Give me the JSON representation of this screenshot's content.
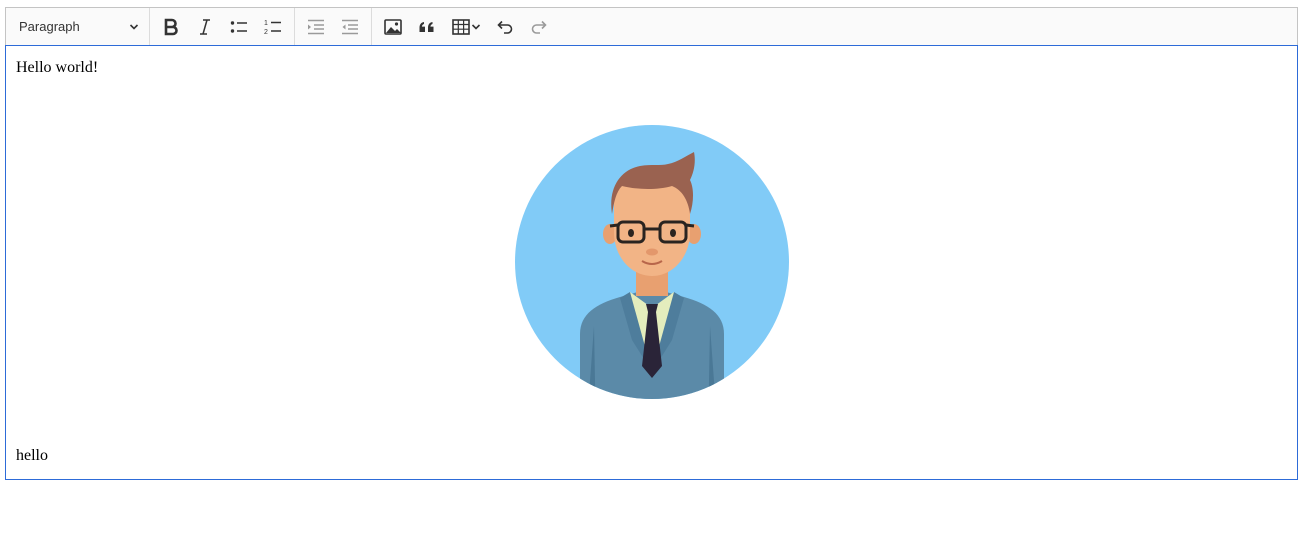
{
  "toolbar": {
    "heading_label": "Paragraph",
    "icons": {
      "dropdown": "chevron-down-icon",
      "bold": "bold-icon",
      "italic": "italic-icon",
      "bulleted_list": "bulleted-list-icon",
      "numbered_list": "numbered-list-icon",
      "decrease_indent": "outdent-icon",
      "increase_indent": "indent-icon",
      "image": "image-icon",
      "quote": "quote-icon",
      "table": "table-icon",
      "undo": "undo-icon",
      "redo": "redo-icon"
    }
  },
  "content": {
    "paragraph1": "Hello world!",
    "image": "businessman-avatar",
    "paragraph2": "hello"
  },
  "colors": {
    "focus_border": "#2d6bd8",
    "toolbar_bg": "#fafafa",
    "avatar_bg": "#81cbf7",
    "suit": "#5b8aa8"
  }
}
